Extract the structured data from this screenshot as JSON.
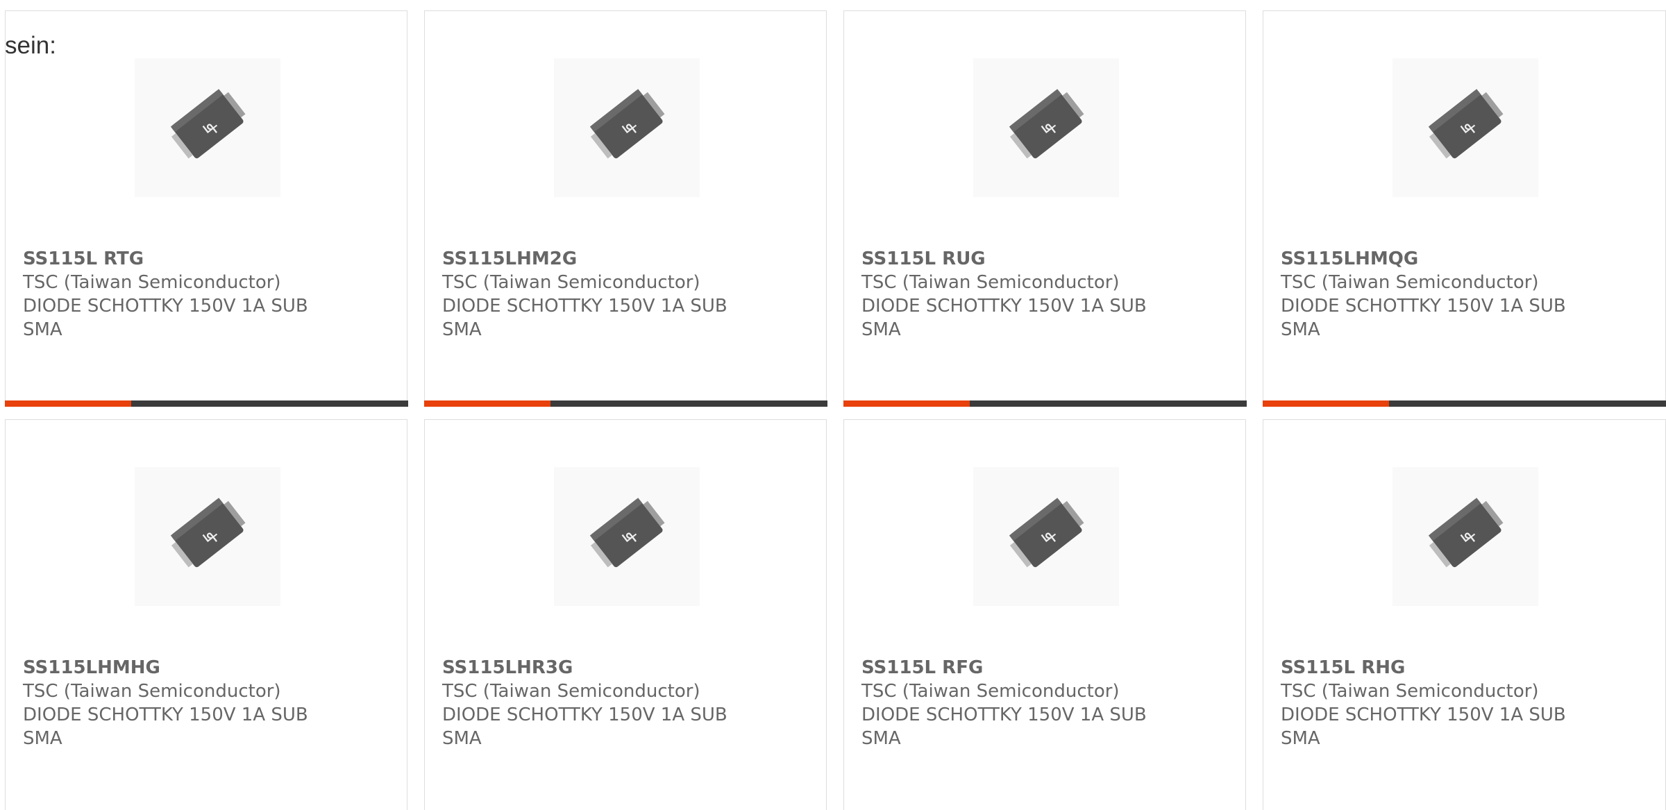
{
  "intro_text": "sein:",
  "products": [
    {
      "part_number": "SS115L RTG",
      "manufacturer": "TSC (Taiwan Semiconductor)",
      "description": "DIODE SCHOTTKY 150V 1A SUB SMA",
      "image_icon": "smd-diode-package-icon"
    },
    {
      "part_number": "SS115LHM2G",
      "manufacturer": "TSC (Taiwan Semiconductor)",
      "description": "DIODE SCHOTTKY 150V 1A SUB SMA",
      "image_icon": "smd-diode-package-icon"
    },
    {
      "part_number": "SS115L RUG",
      "manufacturer": "TSC (Taiwan Semiconductor)",
      "description": "DIODE SCHOTTKY 150V 1A SUB SMA",
      "image_icon": "smd-diode-package-icon"
    },
    {
      "part_number": "SS115LHMQG",
      "manufacturer": "TSC (Taiwan Semiconductor)",
      "description": "DIODE SCHOTTKY 150V 1A SUB SMA",
      "image_icon": "smd-diode-package-icon"
    },
    {
      "part_number": "SS115LHMHG",
      "manufacturer": "TSC (Taiwan Semiconductor)",
      "description": "DIODE SCHOTTKY 150V 1A SUB SMA",
      "image_icon": "smd-diode-package-icon"
    },
    {
      "part_number": "SS115LHR3G",
      "manufacturer": "TSC (Taiwan Semiconductor)",
      "description": "DIODE SCHOTTKY 150V 1A SUB SMA",
      "image_icon": "smd-diode-package-icon"
    },
    {
      "part_number": "SS115L RFG",
      "manufacturer": "TSC (Taiwan Semiconductor)",
      "description": "DIODE SCHOTTKY 150V 1A SUB SMA",
      "image_icon": "smd-diode-package-icon"
    },
    {
      "part_number": "SS115L RHG",
      "manufacturer": "TSC (Taiwan Semiconductor)",
      "description": "DIODE SCHOTTKY 150V 1A SUB SMA",
      "image_icon": "smd-diode-package-icon"
    }
  ],
  "colors": {
    "accent": "#e8410b",
    "bar_dark": "#3b3b3b",
    "text": "#666666",
    "border": "#dddddd"
  }
}
